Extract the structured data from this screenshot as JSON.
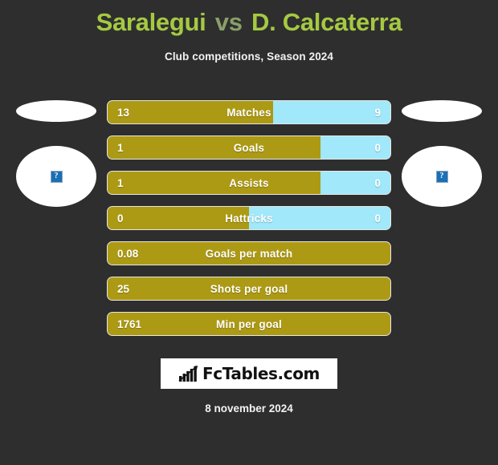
{
  "header": {
    "home_player": "Saralegui",
    "vs": "vs",
    "away_player": "D. Calcaterra",
    "subtitle": "Club competitions, Season 2024"
  },
  "avatars": {
    "home_name_placeholder": "",
    "home_photo_placeholder": "?",
    "away_name_placeholder": "",
    "away_photo_placeholder": "?"
  },
  "footer": {
    "date": "8 november 2024",
    "logo_text": "FcTables.com"
  },
  "colors": {
    "background": "#2e2e2e",
    "home_bar": "#ad9a14",
    "away_bar": "#a0e8fa",
    "title_name": "#a5c942",
    "title_vs": "#8b9e6a",
    "bar_border": "#e8e8e0",
    "text": "#ffffff"
  },
  "chart_data": {
    "type": "bar",
    "title": "Saralegui vs D. Calcaterra",
    "subtitle": "Club competitions, Season 2024",
    "orientation": "horizontal",
    "layout": "diverging-comparison",
    "legend_position": "none",
    "grid": false,
    "series": [
      {
        "name": "Saralegui",
        "color": "#ad9a14",
        "values": [
          13,
          1,
          1,
          0,
          0.08,
          25,
          1761
        ]
      },
      {
        "name": "D. Calcaterra",
        "color": "#a0e8fa",
        "values": [
          9,
          0,
          0,
          0,
          null,
          null,
          null
        ]
      }
    ],
    "categories": [
      "Matches",
      "Goals",
      "Assists",
      "Hattricks",
      "Goals per match",
      "Shots per goal",
      "Min per goal"
    ],
    "rows": [
      {
        "label": "Matches",
        "home_value": "13",
        "away_value": "9",
        "home_pct": 58.5,
        "away_shown": true
      },
      {
        "label": "Goals",
        "home_value": "1",
        "away_value": "0",
        "home_pct": 75.4,
        "away_shown": true
      },
      {
        "label": "Assists",
        "home_value": "1",
        "away_value": "0",
        "home_pct": 75.4,
        "away_shown": true
      },
      {
        "label": "Hattricks",
        "home_value": "0",
        "away_value": "0",
        "home_pct": 50.0,
        "away_shown": true
      },
      {
        "label": "Goals per match",
        "home_value": "0.08",
        "away_value": "",
        "home_pct": 100,
        "away_shown": false
      },
      {
        "label": "Shots per goal",
        "home_value": "25",
        "away_value": "",
        "home_pct": 100,
        "away_shown": false
      },
      {
        "label": "Min per goal",
        "home_value": "1761",
        "away_value": "",
        "home_pct": 100,
        "away_shown": false
      }
    ]
  }
}
